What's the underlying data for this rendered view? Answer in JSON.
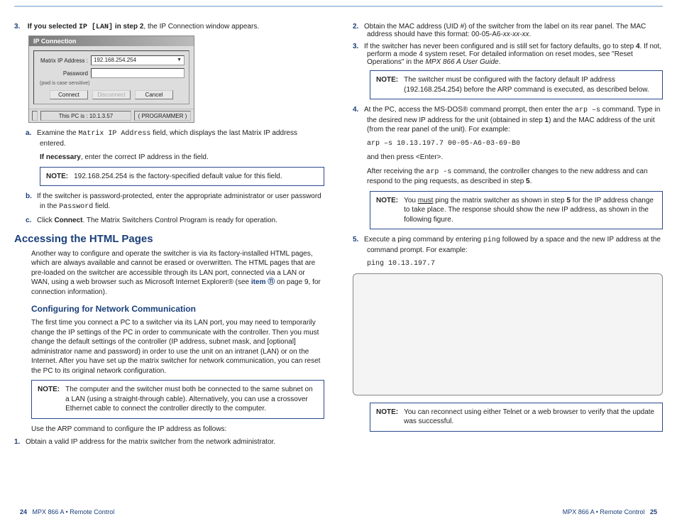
{
  "left": {
    "step3": {
      "num": "3.",
      "lead_bold": "If you selected ",
      "lead_code": "IP [LAN]",
      "lead_bold2": " in step 2",
      "lead_rest": ", the IP Connection window appears."
    },
    "dialog": {
      "title": "IP Connection",
      "ip_label": "Matrix IP Address :",
      "ip_value": "192.168.254.254",
      "pwd_label": "Password",
      "sens": "(pwd is case sensitive)",
      "btn_connect": "Connect",
      "btn_disconnect": "Disconnect",
      "btn_cancel": "Cancel",
      "status_ip": "This PC is : 10.1.3.57",
      "status_role": "( PROGRAMMER )"
    },
    "step_a": {
      "alpha": "a.",
      "t1": "Examine the ",
      "code": "Matrix IP Address",
      "t2": " field, which displays the last Matrix IP address entered.",
      "ifnec": "If necessary",
      "ifnec_rest": ", enter the correct IP address in the field."
    },
    "note1": {
      "label": "NOTE:",
      "text": "192.168.254.254 is the factory-specified default value for this field."
    },
    "step_b": {
      "alpha": "b.",
      "t1": "If the switcher is password-protected, enter the appropriate administrator or user password in the ",
      "code": "Password",
      "t2": " field."
    },
    "step_c": {
      "alpha": "c.",
      "t1": "Click ",
      "bold": "Connect",
      "t2": ". The Matrix Switchers Control Program is ready for operation."
    },
    "h2": "Accessing the HTML Pages",
    "para_html": "Another way to configure and operate the switcher is via its factory-installed HTML pages, which are always available and cannot be erased or overwritten. The HTML pages that are pre-loaded on the switcher are accessible through its LAN port, connected via a LAN or WAN, using a web browser such as Microsoft Internet Explorer® (see ",
    "para_html_link": "item ⑪",
    "para_html_rest": " on page 9, for connection information).",
    "h3": "Configuring for Network Communication",
    "para_config": "The first time you connect a PC to a switcher via its LAN port, you may need to temporarily change the IP settings of the PC in order to communicate with the controller. Then you must change the default settings of the controller (IP address, subnet mask, and [optional] administrator name and password) in order to use the unit on an intranet (LAN) or on the Internet. After you have set up the matrix switcher for network communication, you can reset the PC to its original network configuration.",
    "note2": {
      "label": "NOTE:",
      "text": "The computer and the switcher must both be connected to the same subnet on a LAN (using a straight-through cable). Alternatively, you can use a crossover Ethernet cable to connect the controller directly to the computer."
    },
    "arp_intro": "Use the ARP command to configure the IP address as follows:",
    "arp1": {
      "num": "1.",
      "text": "Obtain a valid IP address for the matrix switcher from the network administrator."
    }
  },
  "right": {
    "arp2": {
      "num": "2.",
      "t1": "Obtain the MAC address (UID #) of the switcher from the label on its rear panel. The MAC address should have this format: 00-05-A6-",
      "italic": "xx-xx-xx",
      "t2": "."
    },
    "arp3": {
      "num": "3.",
      "t1": "If the switcher has never been configured and is still set for factory defaults, go to step ",
      "bold4": "4",
      "t2": ". If not, perform a mode 4 system reset. For detailed information on reset modes, see \"Reset Operations\" in the ",
      "italic": "MPX 866 A User Guide",
      "t3": "."
    },
    "note3": {
      "label": "NOTE:",
      "text": "The switcher must be configured with the factory default IP address (192.168.254.254) before the ARP command is executed, as described below."
    },
    "arp4": {
      "num": "4.",
      "t1": "At the PC, access the MS-DOS® command prompt, then enter the ",
      "code1": "arp –s",
      "t2": " command. Type in the desired new IP address for the unit (obtained in step ",
      "bold1": "1",
      "t3": ") and the MAC address of the unit (from the rear panel of the unit). For example:",
      "code_line": "arp –s 10.13.197.7 00-05-A6-03-69-B0",
      "t4": "and then press <Enter>.",
      "t5a": "After receiving the ",
      "code2": "arp -s",
      "t5b": " command, the controller changes to the new address and can respond to the ping requests, as described in step ",
      "bold5": "5",
      "t5c": "."
    },
    "note4": {
      "label": "NOTE:",
      "t1": "You ",
      "under": "must",
      "t2": " ping the matrix switcher as shown in step ",
      "bold5": "5",
      "t3": " for the IP address change to take place. The response should show the new IP address, as shown in the following figure."
    },
    "arp5": {
      "num": "5.",
      "t1": "Execute a ping command by entering ",
      "code1": "ping",
      "t2": " followed by a space and the new IP address at the command prompt. For example:",
      "code_line": "ping 10.13.197.7"
    },
    "note5": {
      "label": "NOTE:",
      "text": "You can reconnect using either Telnet or a web browser to verify that the update was successful."
    }
  },
  "footer": {
    "left_page": "24",
    "left_text": "MPX 866 A • Remote Control",
    "right_text": "MPX 866 A • Remote Control",
    "right_page": "25"
  }
}
